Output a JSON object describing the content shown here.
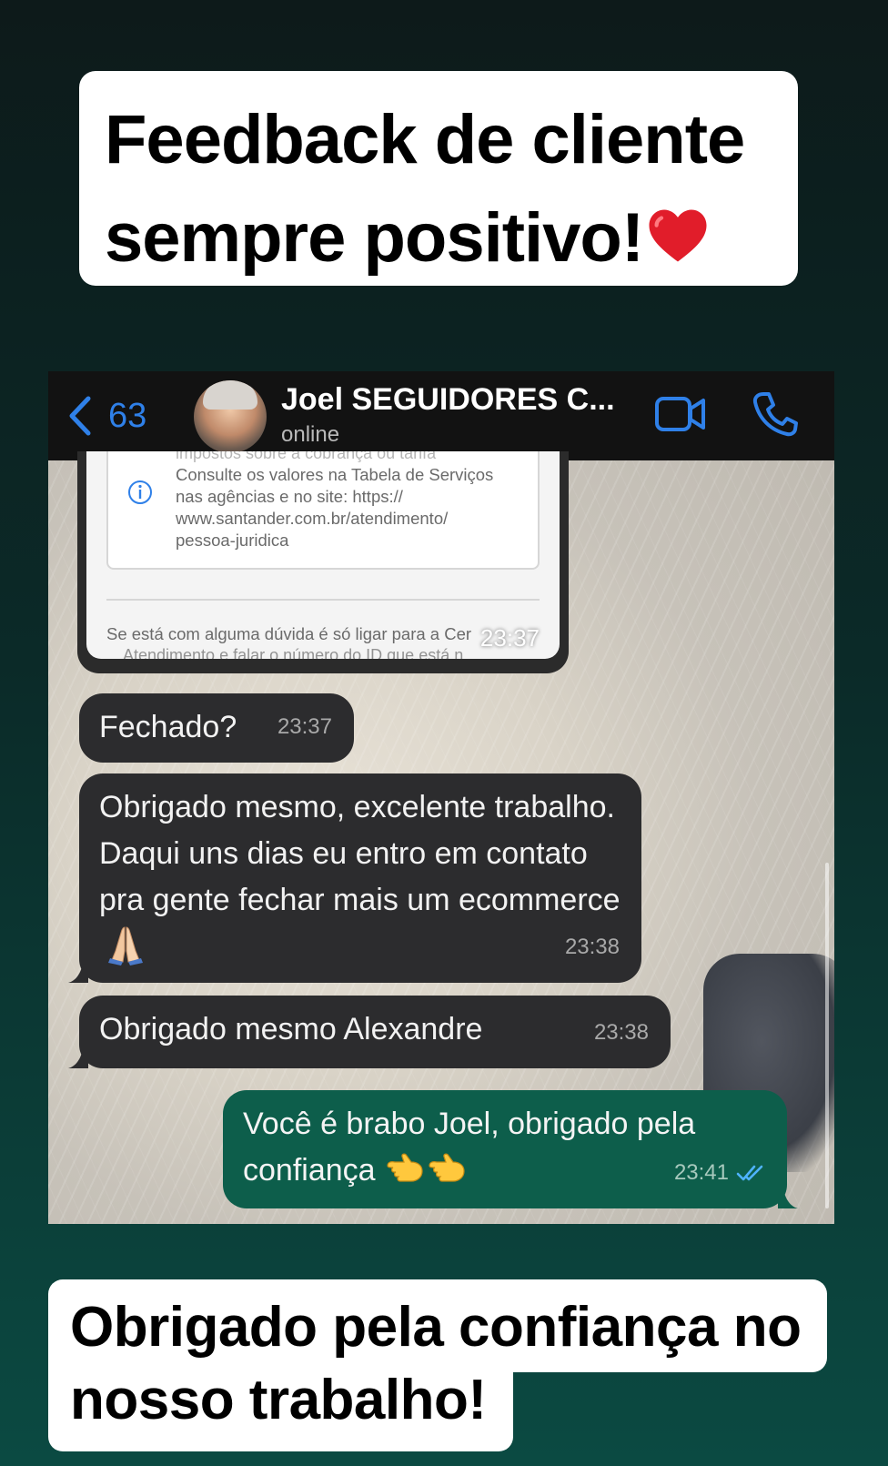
{
  "caption_top": {
    "line1": "Feedback de cliente",
    "line2": "sempre positivo!"
  },
  "header": {
    "back_count": "63",
    "contact_name": "Joel SEGUIDORES C...",
    "status": "online"
  },
  "receipt": {
    "faded_top": "impostos sobre a cobrança ou tarifa",
    "text": "Consulte os valores na Tabela de Serviços\nnas agências e no site: https://\nwww.santander.com.br/atendimento/\npessoa-juridica",
    "bottom_line1": "Se está com alguma dúvida é só ligar para a Cer",
    "bottom_line2": "Atendimento e falar o número do ID que está n",
    "time": "23:37"
  },
  "messages": [
    {
      "text": "Fechado?",
      "time": "23:37",
      "direction": "incoming"
    },
    {
      "text": "Obrigado mesmo, excelente trabalho. Daqui uns dias eu entro em contato pra gente fechar mais um ecommerce",
      "emoji": "folded-hands",
      "time": "23:38",
      "direction": "incoming"
    },
    {
      "text": "Obrigado mesmo Alexandre",
      "time": "23:38",
      "direction": "incoming"
    },
    {
      "text": "Você é brabo Joel, obrigado pela confiança",
      "emoji": "backhand-index-pointing-left x2",
      "time": "23:41",
      "direction": "outgoing",
      "status": "read"
    }
  ],
  "caption_bottom": {
    "line1": "Obrigado pela confiança no",
    "line2": "nosso trabalho!"
  },
  "colors": {
    "accent_blue": "#2f80e8",
    "incoming_bubble": "#2c2c2e",
    "outgoing_bubble": "#0d5e4b",
    "heart": "#e11d2a"
  }
}
